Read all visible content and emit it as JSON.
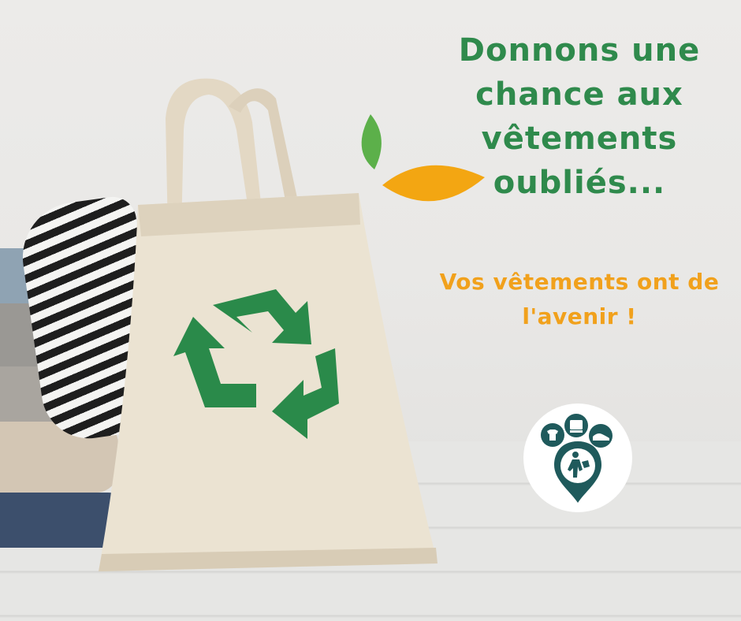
{
  "headline": {
    "text": "Donnons une chance aux vêtements oubliés..."
  },
  "subline": {
    "text": "Vos vêtements ont de l'avenir !"
  },
  "bag": {
    "icon": "recycle-icon"
  },
  "logo": {
    "icons": [
      "tshirt-icon",
      "sweater-icon",
      "shoe-icon",
      "map-pin-icon"
    ]
  },
  "colors": {
    "headline": "#2f8a4c",
    "subline": "#f1a11c",
    "recycle": "#2a8a4a",
    "leaf_green": "#5cb04a",
    "leaf_orange": "#f3a612",
    "logo_teal": "#1f5a5c"
  }
}
